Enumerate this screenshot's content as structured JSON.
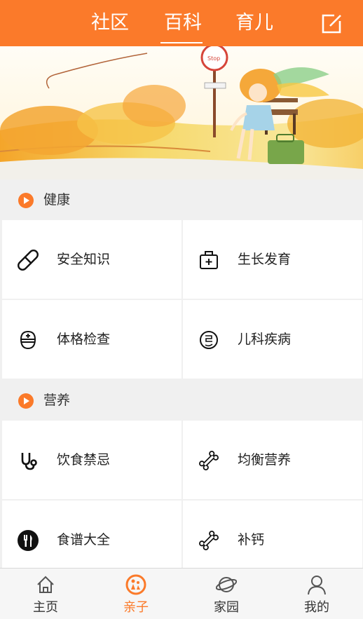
{
  "header": {
    "tabs": [
      {
        "label": "社区"
      },
      {
        "label": "百科",
        "active": true
      },
      {
        "label": "育儿"
      }
    ],
    "edit_icon": "edit-icon"
  },
  "banner": {
    "image": "autumn-girl-on-bench-illustration",
    "sign_text": "Stop"
  },
  "sections": [
    {
      "title": "健康",
      "items": [
        {
          "label": "安全知识",
          "icon": "pill-icon"
        },
        {
          "label": "生长发育",
          "icon": "medical-kit-icon"
        },
        {
          "label": "体格检查",
          "icon": "nurse-icon"
        },
        {
          "label": "儿科疾病",
          "icon": "avoid-icon"
        }
      ]
    },
    {
      "title": "营养",
      "items": [
        {
          "label": "饮食禁忌",
          "icon": "stethoscope-icon"
        },
        {
          "label": "均衡营养",
          "icon": "bone-icon"
        },
        {
          "label": "食谱大全",
          "icon": "cutlery-icon"
        },
        {
          "label": "补钙",
          "icon": "bone-icon"
        }
      ]
    }
  ],
  "bottom_nav": [
    {
      "label": "主页",
      "icon": "home-icon"
    },
    {
      "label": "亲子",
      "icon": "family-icon",
      "active": true
    },
    {
      "label": "家园",
      "icon": "planet-icon"
    },
    {
      "label": "我的",
      "icon": "user-icon"
    }
  ],
  "colors": {
    "accent": "#fb7a2a",
    "background": "#f0f0f0",
    "card": "#ffffff",
    "text": "#222222"
  }
}
